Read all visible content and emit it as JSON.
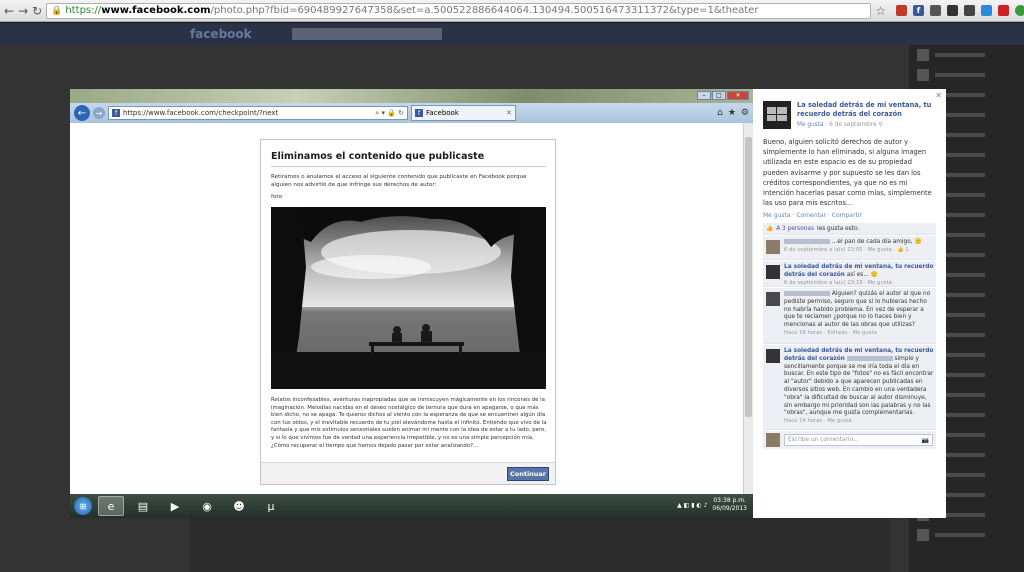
{
  "browser": {
    "url_scheme": "https://",
    "url_host": "www.facebook.com",
    "url_path": "/photo.php?fbid=690489927647358&set=a.500522886644064.130494.500516473311372&type=1&theater"
  },
  "background_fb": {
    "logo": "facebook"
  },
  "inner_browser": {
    "address": "https://www.facebook.com/checkpoint/?next",
    "tab_label": "Facebook"
  },
  "checkpoint": {
    "title": "Eliminamos el contenido que publicaste",
    "intro": "Retiramos o anulamos el acceso al siguiente contenido que publicaste en Facebook porque alguien nos advirtió de que infringe sus derechos de autor:",
    "item_label": "foto",
    "body": "Relatos inconfesables, aventuras inapropiadas que se inmiscuyen mágicamente en los rincones de la imaginación. Melodías nacidas en el deseo nostálgico de ternura que dura en apagarse, o que más bien dicho, no se apaga. Te quieros dichos al viento con la esperanza de que se encuentren algún día con tus oídos, y el inevitable recuerdo de tu piel elevándome hasta el infinito. Entiendo que vivo de la fantasía y que mis estímulos sensoriales suelen animar mi mente con la idea de estar a tu lado, pero, y si lo que vivimos fue de verdad una experiencia irrepetible, y no es una simple percepción mía, ¿Cómo recuperar el tiempo que hemos dejado pasar por estar analizando?...",
    "continue_label": "Continuar"
  },
  "taskbar": {
    "time": "03:38 p.m.",
    "date": "06/09/2013"
  },
  "panel": {
    "page_name": "La soledad detrás de mi ventana, tu recuerdo detrás del corazón",
    "meta_like": "Me gusta",
    "meta_date": "· 6 de septiembre",
    "post_text": "Bueno, alguien solicitó derechos de autor y simplemente lo han eliminado, si alguna imagen utilizada en este espacio es de su propiedad pueden avisarme y por supuesto se les dan los créditos correspondientes, ya que no es mi intención hacerlas pasar como mías, simplemente las uso para mis escritos...",
    "actions": [
      "Me gusta",
      "Comentar",
      "Compartir"
    ],
    "likes_count": "A 3 personas",
    "likes_suffix": "les gusta esto.",
    "comments": [
      {
        "name": "",
        "text": "...el pan de cada día amigo, 🙂",
        "meta": "6 de septiembre a la(s) 23:05 · Me gusta · 👍 1"
      },
      {
        "name": "La soledad detrás de mi ventana, tu recuerdo detrás del corazón",
        "text": "así es... 🙂",
        "meta": "6 de septiembre a la(s) 23:18 · Me gusta"
      },
      {
        "name": "",
        "text": "Alguien? quizás el autor al que no pediste permiso, seguro que si lo hubieras hecho no habría habido problema. En vez de esperar a que te reclamen ¿porque no lo haces bien y mencionas al autor de las obras que utilizas?",
        "meta": "Hace 16 horas · Editado · Me gusta"
      },
      {
        "name": "La soledad detrás de mi ventana, tu recuerdo detrás del corazón",
        "text": "simple y sencillamente porque se me iría toda el día en buscar. En este tipo de \"fotos\" no es fácil encontrar al \"autor\" debido a que aparecen publicadas en diversos sitios web. En cambio en una verdadera \"obra\" la dificultad de buscar al autor disminuye, sin embargo mi prioridad son las palabras y no las \"obras\", aunque me gusta complementarlas.",
        "meta": "Hace 14 horas · Me gusta"
      }
    ],
    "comment_placeholder": "Escribe un comentario..."
  }
}
